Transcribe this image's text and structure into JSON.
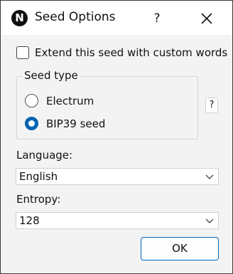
{
  "window": {
    "title": "Seed Options",
    "icon_letter": "N",
    "help_label": "?"
  },
  "options": {
    "extend_label": "Extend this seed with custom words",
    "extend_checked": false
  },
  "seed_type": {
    "title": "Seed type",
    "options": [
      {
        "label": "Electrum",
        "checked": false
      },
      {
        "label": "BIP39 seed",
        "checked": true
      }
    ],
    "help_label": "?"
  },
  "language": {
    "label": "Language:",
    "value": "English"
  },
  "entropy": {
    "label": "Entropy:",
    "value": "128"
  },
  "buttons": {
    "ok_label": "OK"
  }
}
